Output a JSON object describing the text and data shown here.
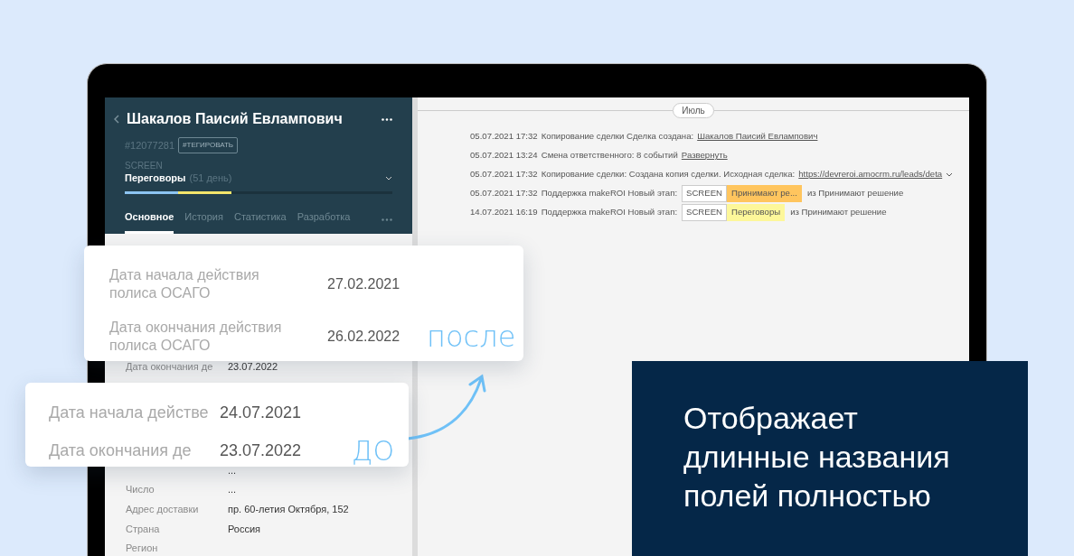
{
  "lead": {
    "name": "Шакалов Паисий Евлампович",
    "number": "#12077281",
    "tag_button": "#ТЕГИРОВАТЬ",
    "pipeline": "SCREEN",
    "stage": "Переговоры",
    "stage_duration": "(51 день)",
    "progress": [
      {
        "color": "#8cc4f2",
        "level": 0.2
      },
      {
        "color": "#f3e56b",
        "level": 0.2
      }
    ],
    "tabs": [
      {
        "label": "Основное",
        "selected": true
      },
      {
        "label": "История",
        "selected": false
      },
      {
        "label": "Статистика",
        "selected": false
      },
      {
        "label": "Разработка",
        "selected": false
      }
    ],
    "fields": [
      {
        "label": "Дата окончания де",
        "value": "23.07.2022"
      },
      {
        "value": "..."
      },
      {
        "label": "Число",
        "value": "..."
      },
      {
        "label": "Адрес доставки",
        "value": "пр. 60-летия Октября, 152"
      },
      {
        "label": "Страна",
        "value": "Россия"
      },
      {
        "label": "Регион"
      }
    ]
  },
  "feed": {
    "month": "Июль",
    "entries": [
      {
        "kind": "link",
        "datetime": "05.07.2021 17:32",
        "text": "Копирование сделки Сделка создана:",
        "link": "Шакалов Паисий Евлампович",
        "expandable": false
      },
      {
        "kind": "link",
        "datetime": "05.07.2021 13:24",
        "text": "Смена ответственного: 8 событий",
        "link": "Развернуть",
        "expandable": false
      },
      {
        "kind": "link",
        "datetime": "05.07.2021 17:32",
        "text": "Копирование сделки: Создана копия сделки. Исходная сделка:",
        "link": "https://devreroi.amocrm.ru/leads/deta",
        "expandable": true
      },
      {
        "kind": "stage",
        "datetime": "05.07.2021 17:32",
        "text": "Поддержка makeROI Новый этап:",
        "pipeline": "SCREEN",
        "stage": "Принимают ре...",
        "color": "#ffc55e",
        "from": "из Принимают решение",
        "expandable": false
      },
      {
        "kind": "stage",
        "datetime": "14.07.2021 16:19",
        "text": "Поддержка makeROI Новый этап:",
        "pipeline": "SCREEN",
        "stage": "Переговоры",
        "color": "#fdf79a",
        "from": "из Принимают решение",
        "expandable": false
      }
    ]
  },
  "after_card": {
    "note": "после",
    "fields": [
      {
        "label": "Дата начала действия полиса ОСАГО",
        "value": "27.02.2021"
      },
      {
        "label": "Дата окончания действия полиса ОСАГО",
        "value": "26.02.2022"
      }
    ]
  },
  "before_card": {
    "note": "ДО",
    "fields": [
      {
        "label": "Дата начала действе",
        "value": "24.07.2021"
      },
      {
        "label": "Дата окончания де",
        "value": "23.07.2022"
      }
    ]
  },
  "promo": {
    "lines": [
      "Отображает",
      "длинные названия",
      "полей полностью"
    ]
  }
}
